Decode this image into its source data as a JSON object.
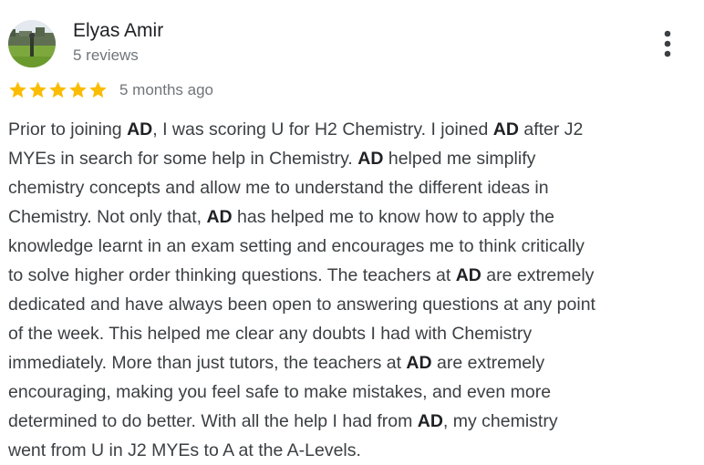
{
  "review": {
    "author": {
      "name": "Elyas Amir",
      "reviews_count": "5 reviews",
      "avatar_icon": "landscape-avatar"
    },
    "rating": 5,
    "rating_max": 5,
    "star_color": "#fbbc04",
    "time": "5 months ago",
    "more_icon": "more-vert-icon",
    "lines": [
      [
        "Prior to joining ",
        {
          "bold": "AD"
        },
        ", I was scoring U for H2 Chemistry. I joined ",
        {
          "bold": "AD"
        },
        " after J2"
      ],
      [
        "MYEs in search for some help in Chemistry. ",
        {
          "bold": "AD"
        },
        " helped me simplify"
      ],
      [
        "chemistry concepts and allow me to understand the different ideas in"
      ],
      [
        "Chemistry. Not only that, ",
        {
          "bold": "AD"
        },
        " has helped me to know how to apply the"
      ],
      [
        "knowledge learnt in an exam setting and encourages me to think critically"
      ],
      [
        "to solve higher order thinking questions. The teachers at ",
        {
          "bold": "AD"
        },
        " are extremely"
      ],
      [
        "dedicated and have always been open to answering questions at any point"
      ],
      [
        "of the week. This helped me clear any doubts I had with Chemistry"
      ],
      [
        "immediately. More than just tutors, the teachers at ",
        {
          "bold": "AD"
        },
        " are extremely"
      ],
      [
        "encouraging, making you feel safe to make mistakes, and even more"
      ],
      [
        "determined to do better. With all the help I had from ",
        {
          "bold": "AD"
        },
        ", my chemistry"
      ],
      [
        "went from U in J2 MYEs to A at the A-Levels."
      ]
    ]
  }
}
